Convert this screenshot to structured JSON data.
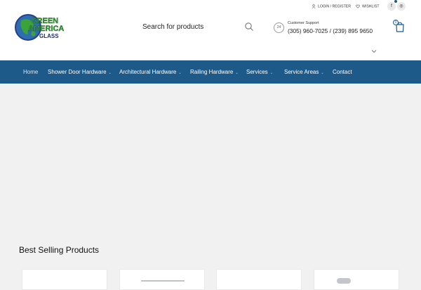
{
  "logo": {
    "line1": "GREEN",
    "line2": "AMERICA",
    "line3": "GLASS"
  },
  "search": {
    "placeholder": "Search for products",
    "icon": "search-icon"
  },
  "support": {
    "badge": "24",
    "title": "Customer Support",
    "phone": "(305) 960-7025 / (239) 895 9650"
  },
  "cart": {
    "count": "0",
    "icon": "shopping-bag-icon"
  },
  "top_links": {
    "login": "LOGIN / REGISTER",
    "wishlist": "WISHLIST"
  },
  "social": {
    "facebook": "f",
    "instagram": "◎"
  },
  "nav": {
    "items": [
      {
        "label": "Home",
        "active": true
      },
      {
        "label": "Shower Door Hardware",
        "caret": "⌄"
      },
      {
        "label": "Architectural Hardware",
        "caret": "⌄"
      },
      {
        "label": "Railing Hardware",
        "caret": "⌄"
      },
      {
        "label": "Services",
        "caret": "⌄"
      },
      {
        "label": "Service Areas",
        "caret": "⌄"
      },
      {
        "label": "Contact"
      }
    ]
  },
  "best_selling": {
    "title": "Best Selling Products"
  },
  "colors": {
    "nav_bg": "#1d5a8a",
    "accent": "#1e5b8c",
    "logo_green": "#3ba33b",
    "page_bg": "#f1f1f1"
  }
}
